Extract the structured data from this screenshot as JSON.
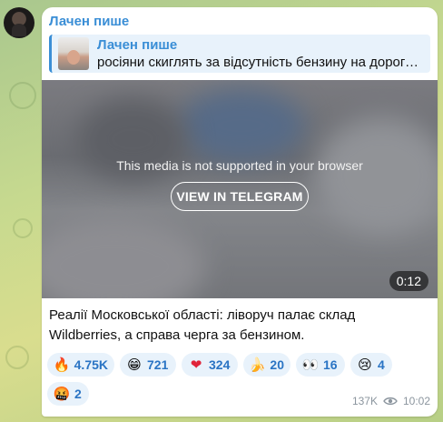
{
  "channel": {
    "name": "Лачен пише"
  },
  "reply": {
    "name": "Лачен пише",
    "text": "росіяни скиглять за відсутність бензину на дорогах у ..."
  },
  "media": {
    "unsupported_text": "This media is not supported in your browser",
    "button_label": "VIEW IN TELEGRAM",
    "duration": "0:12"
  },
  "caption": "Реалії Московської області: ліворуч палає склад Wildberries, а справа черга за бензином.",
  "reactions": [
    {
      "emoji": "🔥",
      "count": "4.75K",
      "icon": "fire-icon"
    },
    {
      "emoji": "😁",
      "count": "721",
      "icon": "grin-icon"
    },
    {
      "emoji": "❤",
      "count": "324",
      "icon": "heart-icon"
    },
    {
      "emoji": "🍌",
      "count": "20",
      "icon": "banana-icon"
    },
    {
      "emoji": "👀",
      "count": "16",
      "icon": "eyes-icon"
    },
    {
      "emoji": "😢",
      "count": "4",
      "icon": "crying-icon"
    },
    {
      "emoji": "🤬",
      "count": "2",
      "icon": "angry-icon"
    }
  ],
  "meta": {
    "views": "137K",
    "time": "10:02"
  },
  "colors": {
    "accent": "#3a8ed6",
    "reaction_bg": "#e8f2fb"
  }
}
